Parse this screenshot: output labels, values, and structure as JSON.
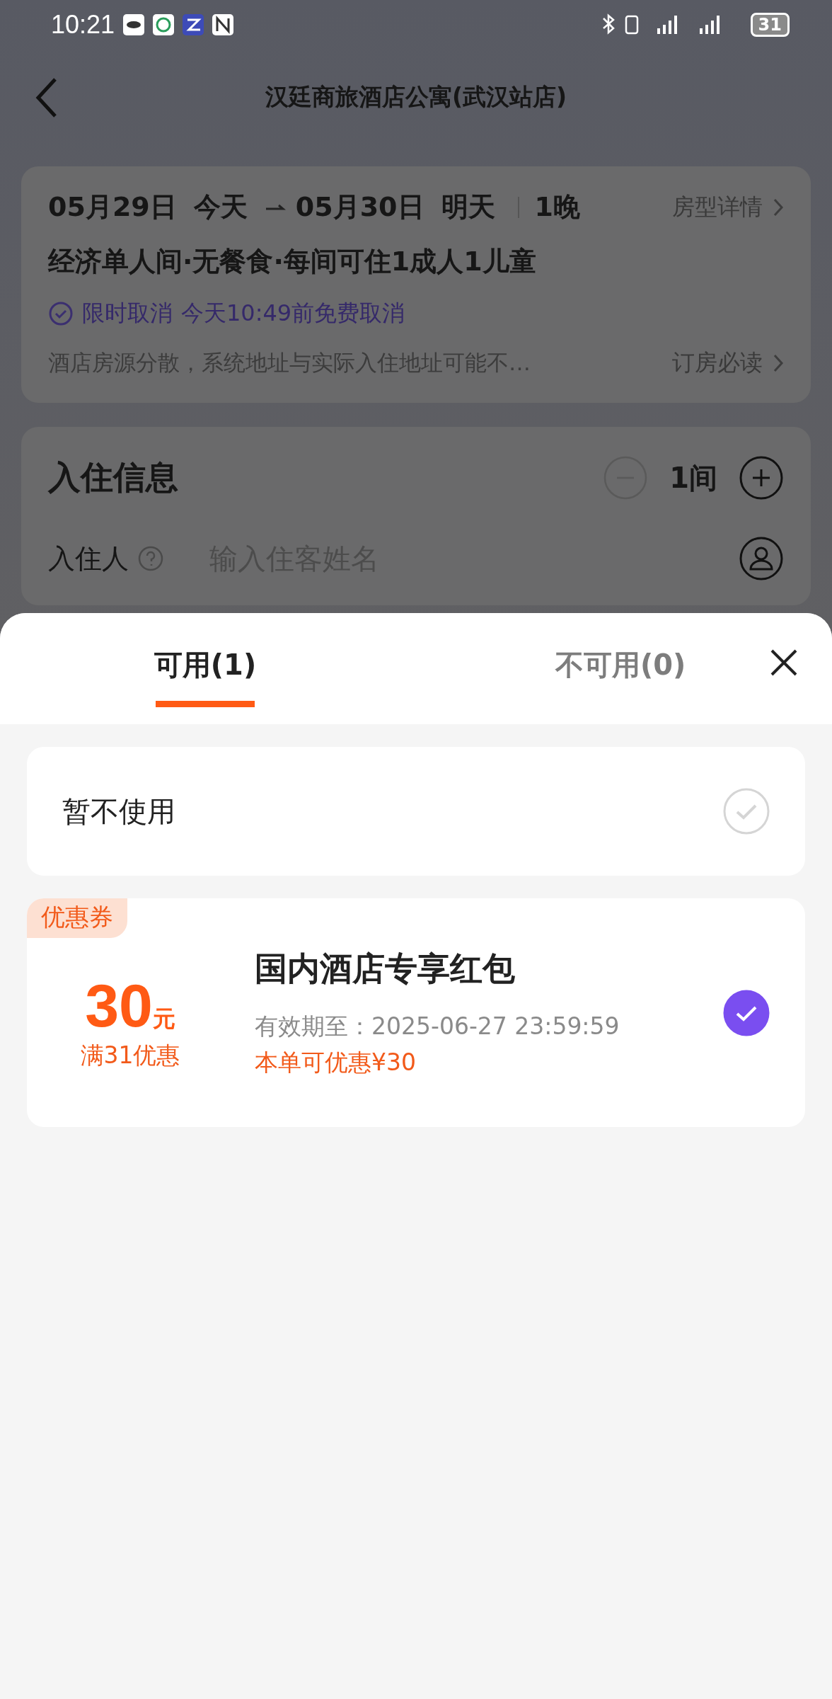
{
  "status_bar": {
    "time": "10:21",
    "battery": "31"
  },
  "header": {
    "title": "汉廷商旅酒店公寓(武汉站店)"
  },
  "booking": {
    "check_in_date": "05月29日",
    "check_in_day": "今天",
    "check_out_date": "05月30日",
    "check_out_day": "明天",
    "nights": "1晚",
    "room_details_link": "房型详情",
    "room": "经济单人间·无餐食·每间可住1成人1儿童",
    "cancel_type": "限时取消",
    "cancel_rule": "今天10:49前免费取消",
    "notice": "酒店房源分散，系统地址与实际入住地址可能不…",
    "notice_link": "订房必读"
  },
  "guest_info": {
    "title": "入住信息",
    "rooms": "1间",
    "guest_label": "入住人",
    "placeholder": "输入住客姓名"
  },
  "sheet": {
    "tabs": [
      {
        "label": "可用(1)",
        "selected": true
      },
      {
        "label": "不可用(0)",
        "selected": false
      }
    ],
    "options": [
      {
        "kind": "none",
        "label": "暂不使用",
        "selected": false
      },
      {
        "kind": "coupon",
        "tag": "优惠券",
        "amount": "30",
        "unit": "元",
        "condition": "满31优惠",
        "title": "国内酒店专享红包",
        "validity": "有效期至：2025-06-27 23:59:59",
        "saving": "本单可优惠¥30",
        "selected": true
      }
    ]
  }
}
